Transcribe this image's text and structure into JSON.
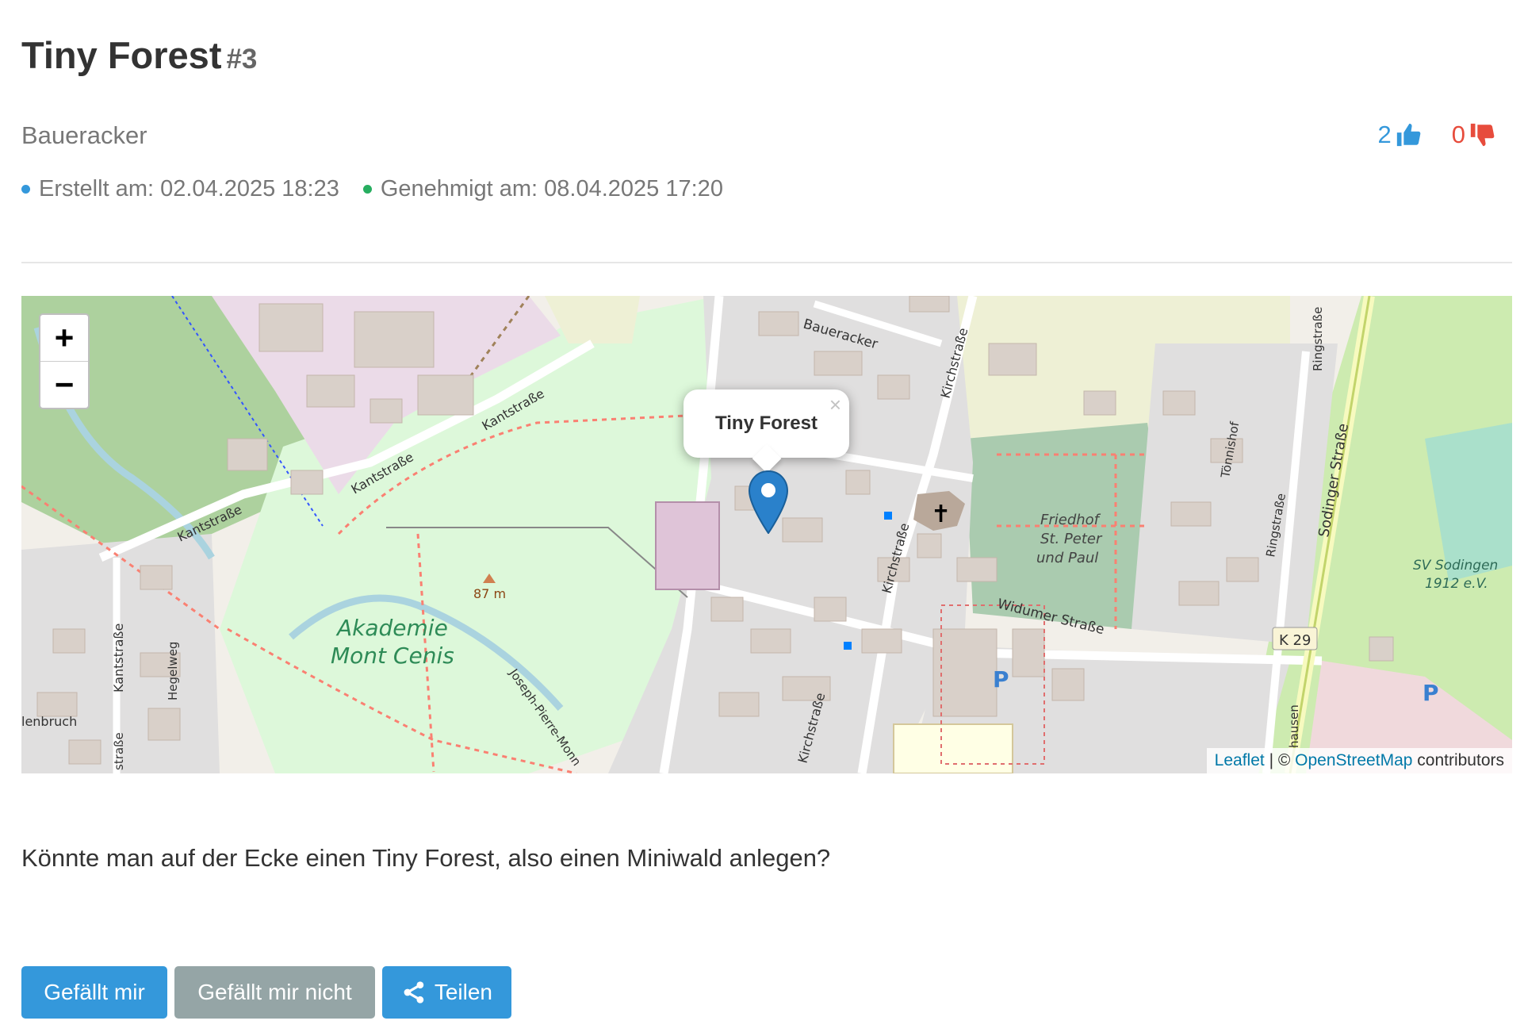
{
  "proposal": {
    "title": "Tiny Forest",
    "number": "#3",
    "location": "Baueracker",
    "created": "Erstellt am: 02.04.2025 18:23",
    "approved": "Genehmigt am: 08.04.2025 17:20",
    "description": "Könnte man auf der Ecke einen Tiny Forest, also einen Miniwald anlegen?"
  },
  "votes": {
    "up": "2",
    "down": "0",
    "up_color": "#3498db",
    "down_color": "#e74c3c"
  },
  "map": {
    "zoom_in": "+",
    "zoom_out": "−",
    "popup_title": "Tiny Forest",
    "popup_close": "×",
    "attribution_leaflet": "Leaflet",
    "attribution_sep": " | © ",
    "attribution_osm": "OpenStreetMap",
    "attribution_suffix": " contributors",
    "labels": {
      "baueracker": "Baueracker",
      "kantstrasse_1": "Kantstraße",
      "kantstrasse_2": "Kantstraße",
      "kantstrasse_3": "Kantstraße",
      "kantstrasse_4": "Kantstraße",
      "kirchstrasse_1": "Kirchstraße",
      "kirchstrasse_2": "Kirchstraße",
      "kirchstrasse_3": "Kirchstraße",
      "akademie": "Akademie",
      "mont_cenis": "Mont Cenis",
      "elevation": "87 m",
      "joseph": "Joseph-Pierre-Monn",
      "friedhof_1": "Friedhof",
      "friedhof_2": "St. Peter",
      "friedhof_3": "und Paul",
      "widumer": "Widumer Straße",
      "toennishof": "Tönnishof",
      "ringstrasse_1": "Ringstraße",
      "ringstrasse_2": "Ringstraße",
      "sodinger": "Sodinger Straße",
      "sv_1": "SV Sodingen",
      "sv_2": "1912 e.V.",
      "k29": "K 29",
      "hegelweg": "Hegelweg",
      "lenbruch": "lenbruch",
      "strasse_edge": "straße",
      "hausen": "hausen",
      "parking": "P"
    }
  },
  "actions": {
    "like": "Gefällt mir",
    "dislike": "Gefällt mir nicht",
    "share": "Teilen"
  }
}
